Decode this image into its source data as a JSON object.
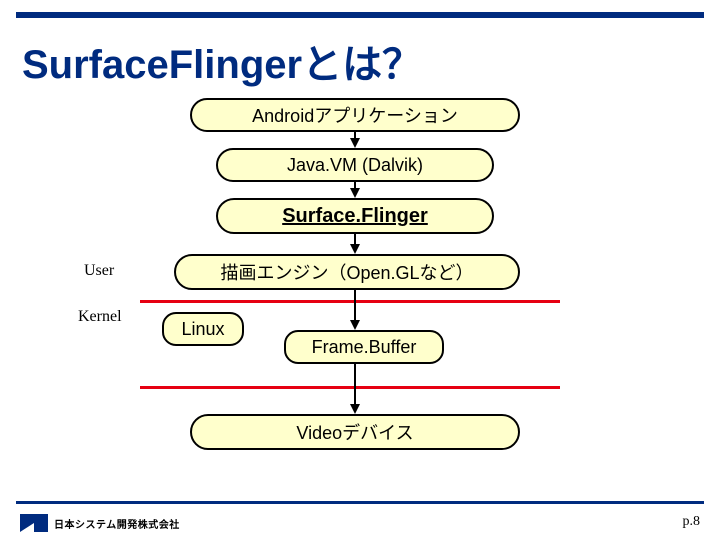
{
  "title": "SurfaceFlingerとは？",
  "boxes": {
    "app": "Androidアプリケーション",
    "jvm": "Java.VM (Dalvik)",
    "sf": "Surface.Flinger",
    "engine": "描画エンジン（Open.GLなど）",
    "linux": "Linux",
    "framebuffer": "Frame.Buffer",
    "video": "Videoデバイス"
  },
  "labels": {
    "user": "User",
    "kernel": "Kernel"
  },
  "footer": {
    "company": "日本システム開発株式会社",
    "page": "p.8"
  },
  "colors": {
    "accent": "#002b7f",
    "red": "#e60012",
    "box_bg": "#ffffcc"
  }
}
